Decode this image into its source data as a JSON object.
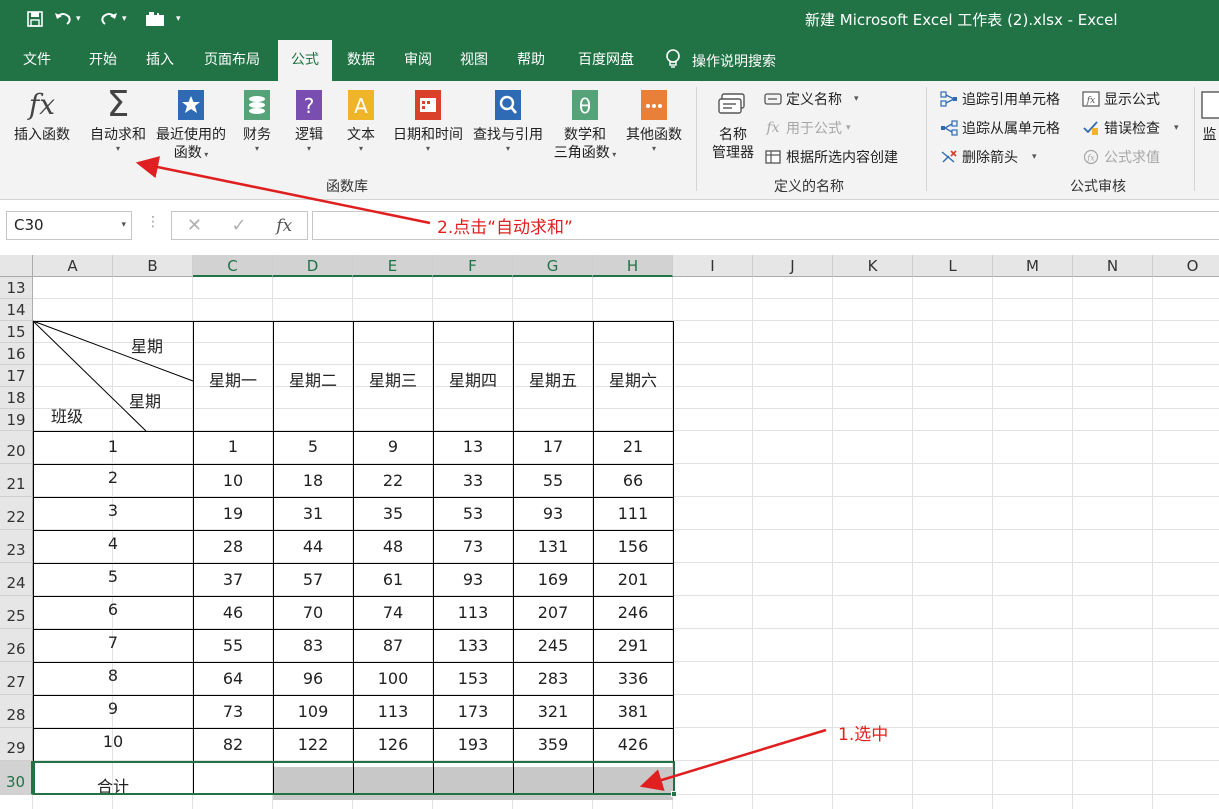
{
  "title_bar": {
    "title": "新建 Microsoft Excel 工作表 (2).xlsx  -  Excel",
    "quick_access": [
      {
        "icon": "save-icon"
      },
      {
        "icon": "undo-icon"
      },
      {
        "icon": "redo-icon"
      },
      {
        "icon": "camera-icon"
      },
      {
        "icon": "customize-dropdown-icon"
      }
    ]
  },
  "tabs": [
    {
      "label": "文件"
    },
    {
      "label": "开始"
    },
    {
      "label": "插入"
    },
    {
      "label": "页面布局"
    },
    {
      "label": "公式",
      "active": true
    },
    {
      "label": "数据"
    },
    {
      "label": "审阅"
    },
    {
      "label": "视图"
    },
    {
      "label": "帮助"
    },
    {
      "label": "百度网盘"
    }
  ],
  "tell_me": {
    "label": "操作说明搜索",
    "icon": "lightbulb-icon"
  },
  "ribbon": {
    "function_library": {
      "group_label": "函数库",
      "insert_function": "插入函数",
      "autosum": "自动求和",
      "recently_used_1": "最近使用的",
      "recently_used_2": "函数",
      "financial": "财务",
      "logical": "逻辑",
      "text": "文本",
      "date_time": "日期和时间",
      "lookup": "查找与引用",
      "math_1": "数学和",
      "math_2": "三角函数",
      "more": "其他函数"
    },
    "defined_names": {
      "group_label": "定义的名称",
      "name_manager_1": "名称",
      "name_manager_2": "管理器",
      "define_name": "定义名称",
      "use_in_formula": "用于公式",
      "create_from_selection": "根据所选内容创建"
    },
    "formula_auditing": {
      "group_label": "公式审核",
      "trace_precedents": "追踪引用单元格",
      "trace_dependents": "追踪从属单元格",
      "remove_arrows": "删除箭头",
      "show_formulas": "显示公式",
      "error_checking": "错误检查",
      "evaluate_formula": "公式求值",
      "watch_partial": "监"
    }
  },
  "formula_bar": {
    "name_box": "C30",
    "formula": ""
  },
  "columns": [
    "A",
    "B",
    "C",
    "D",
    "E",
    "F",
    "G",
    "H",
    "I",
    "J",
    "K",
    "L",
    "M",
    "N",
    "O"
  ],
  "rows": [
    "13",
    "14",
    "15",
    "16",
    "17",
    "18",
    "19",
    "20",
    "21",
    "22",
    "23",
    "24",
    "25",
    "26",
    "27",
    "28",
    "29",
    "30"
  ],
  "table": {
    "header_top": "星期",
    "header_mid": "星期",
    "header_bottom": "班级",
    "days": [
      "星期一",
      "星期二",
      "星期三",
      "星期四",
      "星期五",
      "星期六"
    ],
    "rows": [
      {
        "class": "1",
        "values": [
          "1",
          "5",
          "9",
          "13",
          "17",
          "21"
        ]
      },
      {
        "class": "2",
        "values": [
          "10",
          "18",
          "22",
          "33",
          "55",
          "66"
        ]
      },
      {
        "class": "3",
        "values": [
          "19",
          "31",
          "35",
          "53",
          "93",
          "111"
        ]
      },
      {
        "class": "4",
        "values": [
          "28",
          "44",
          "48",
          "73",
          "131",
          "156"
        ]
      },
      {
        "class": "5",
        "values": [
          "37",
          "57",
          "61",
          "93",
          "169",
          "201"
        ]
      },
      {
        "class": "6",
        "values": [
          "46",
          "70",
          "74",
          "113",
          "207",
          "246"
        ]
      },
      {
        "class": "7",
        "values": [
          "55",
          "83",
          "87",
          "133",
          "245",
          "291"
        ]
      },
      {
        "class": "8",
        "values": [
          "64",
          "96",
          "100",
          "153",
          "283",
          "336"
        ]
      },
      {
        "class": "9",
        "values": [
          "73",
          "109",
          "113",
          "173",
          "321",
          "381"
        ]
      },
      {
        "class": "10",
        "values": [
          "82",
          "122",
          "126",
          "193",
          "359",
          "426"
        ]
      }
    ],
    "total_label": "合计"
  },
  "annotations": {
    "step2": "2.点击“自动求和”",
    "step1": "1.选中",
    "color": "#e02020"
  },
  "colors": {
    "brand": "#217346",
    "selection_fill": "#c8c8c8"
  }
}
